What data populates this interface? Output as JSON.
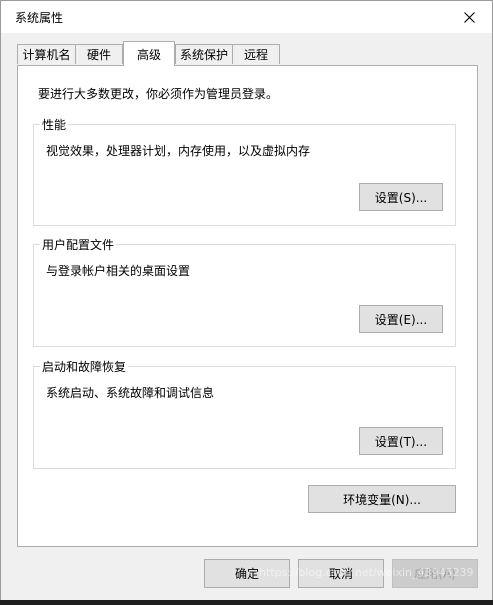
{
  "window": {
    "title": "系统属性"
  },
  "tabs": [
    {
      "label": "计算机名",
      "active": false
    },
    {
      "label": "硬件",
      "active": false
    },
    {
      "label": "高级",
      "active": true
    },
    {
      "label": "系统保护",
      "active": false
    },
    {
      "label": "远程",
      "active": false
    }
  ],
  "advanced": {
    "notice": "要进行大多数更改，你必须作为管理员登录。",
    "performance": {
      "title": "性能",
      "description": "视觉效果，处理器计划，内存使用，以及虚拟内存",
      "button": "设置(S)..."
    },
    "user_profiles": {
      "title": "用户配置文件",
      "description": "与登录帐户相关的桌面设置",
      "button": "设置(E)..."
    },
    "startup_recovery": {
      "title": "启动和故障恢复",
      "description": "系统启动、系统故障和调试信息",
      "button": "设置(T)..."
    },
    "env_button": "环境变量(N)..."
  },
  "footer": {
    "ok": "确定",
    "cancel": "取消",
    "apply": "应用(A)"
  },
  "watermark": "https://blog.csdn.net/weixin_43945239",
  "icons": {
    "close": "close-icon"
  }
}
